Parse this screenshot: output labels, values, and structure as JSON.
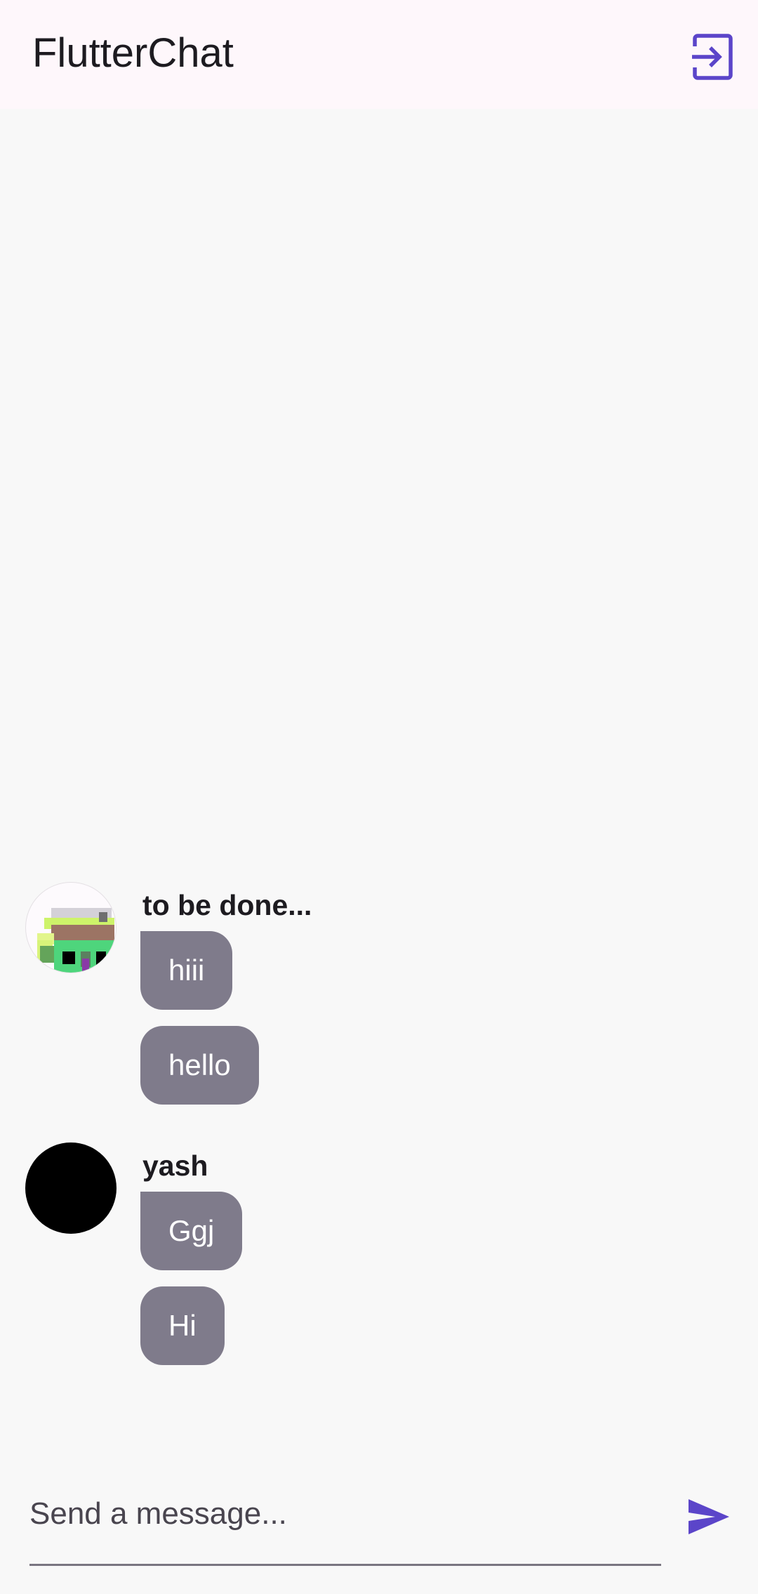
{
  "appbar": {
    "title": "FlutterChat",
    "logout_icon": "logout-icon"
  },
  "messages": [
    {
      "username": "to be done...",
      "avatar": "pixel-art-avatar",
      "bubbles": [
        "hiii",
        "hello"
      ]
    },
    {
      "username": "yash",
      "avatar": "black-avatar",
      "bubbles": [
        "Ggj",
        "Hi"
      ]
    }
  ],
  "composer": {
    "placeholder": "Send a message...",
    "value": "",
    "send_icon": "send-icon"
  },
  "colors": {
    "accent": "#5b45c9",
    "appbar_bg": "#fef7fb",
    "bubble": "#7f7b8b",
    "background": "#f8f8f8"
  }
}
